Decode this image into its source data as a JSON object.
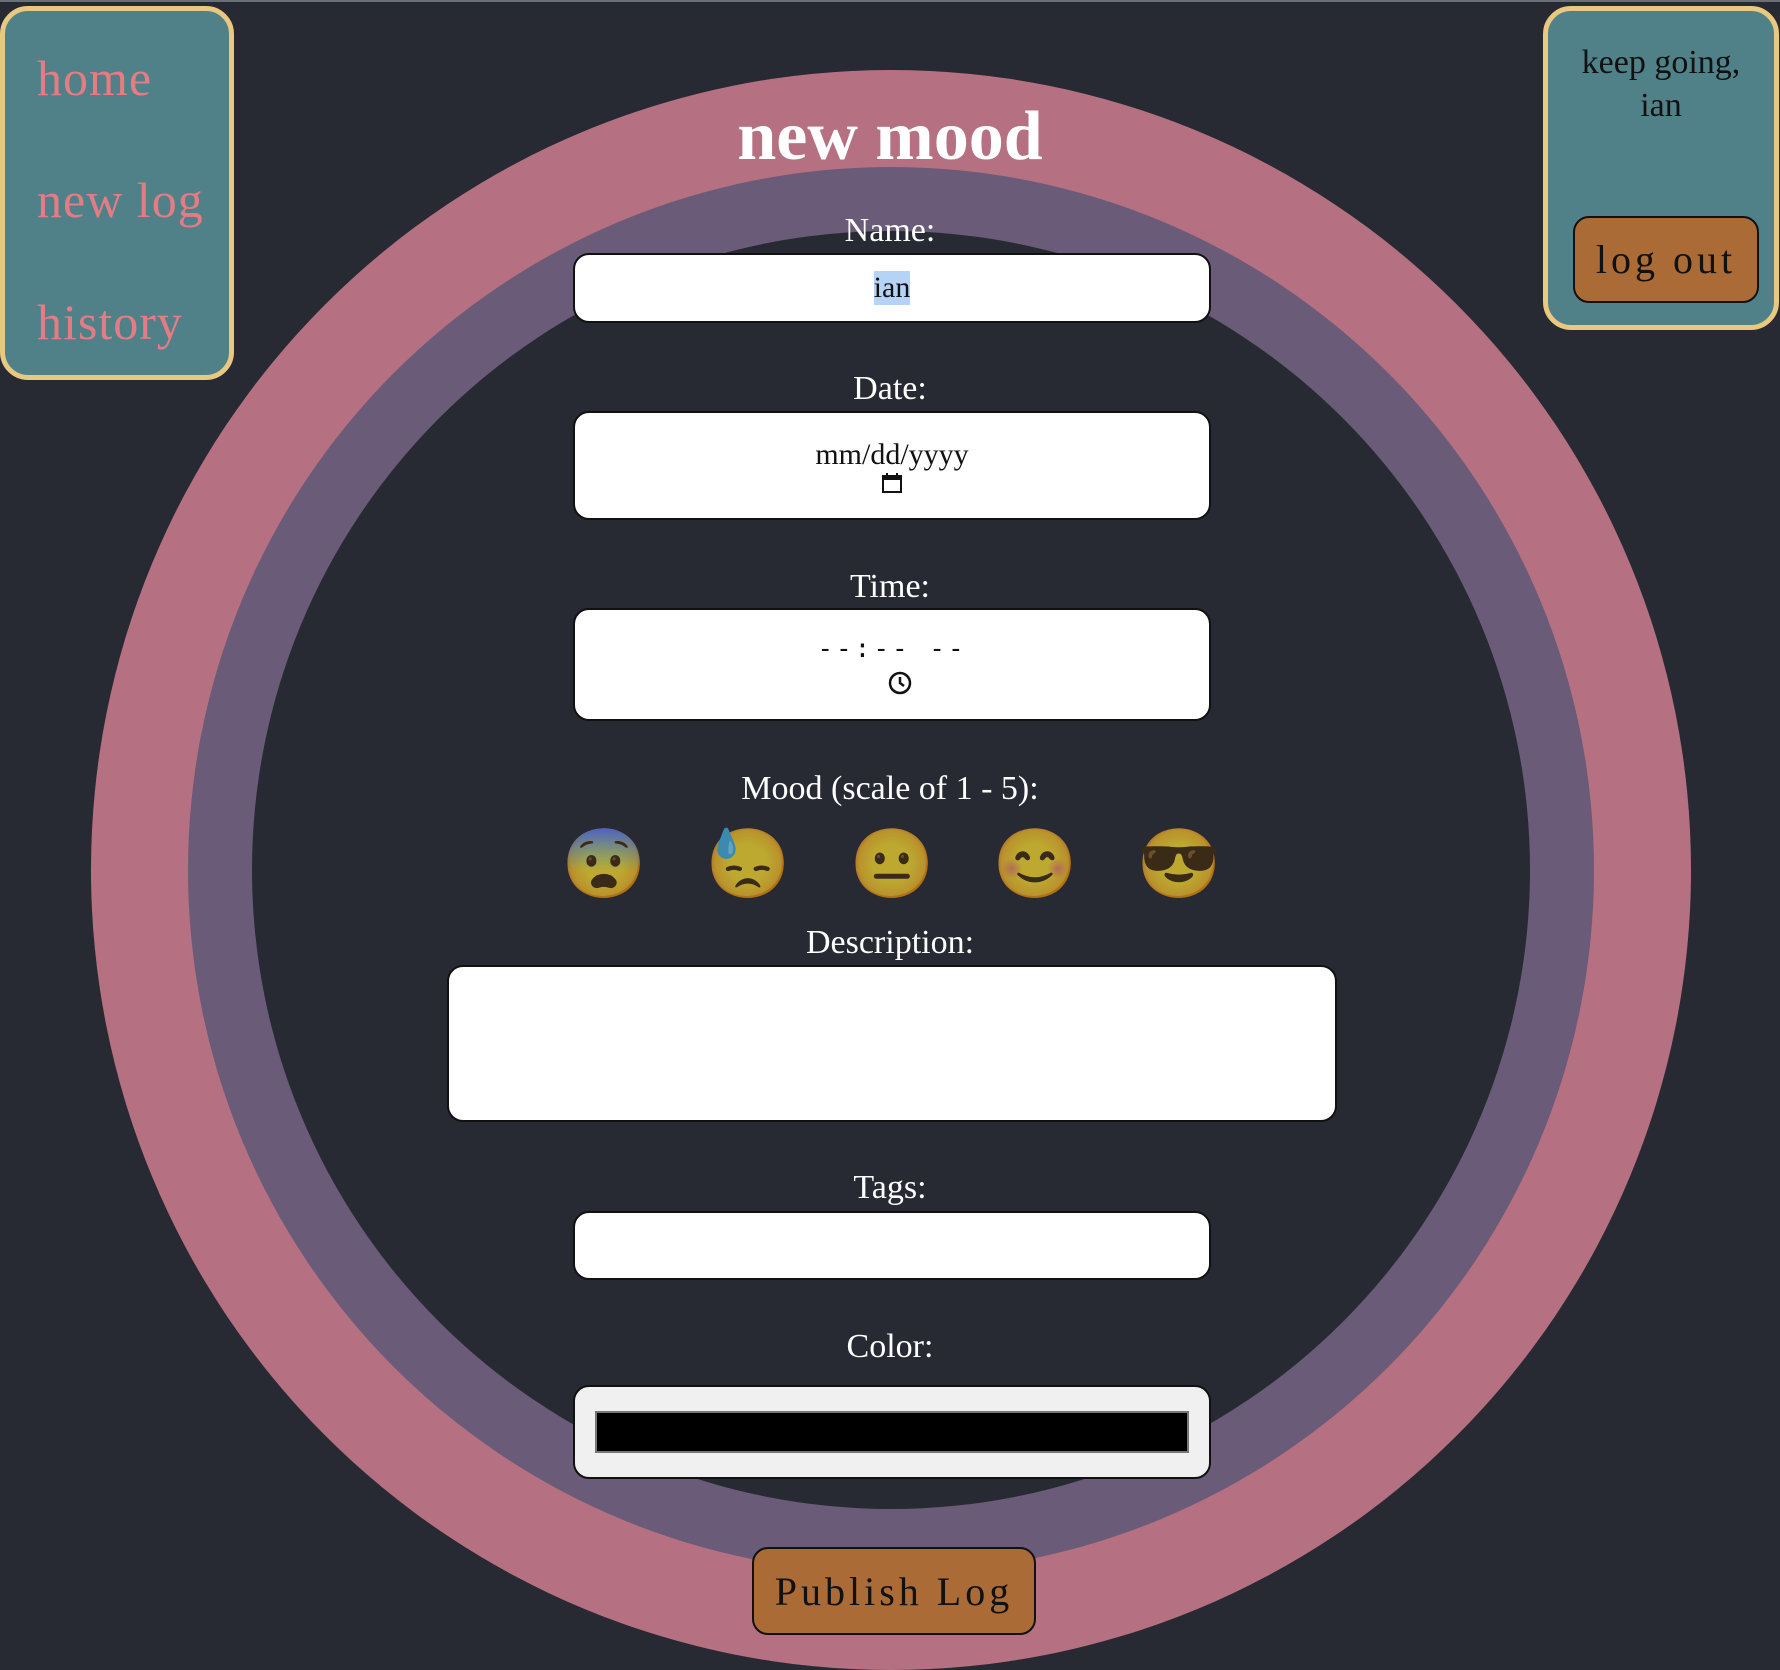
{
  "nav": {
    "items": [
      {
        "label": "home"
      },
      {
        "label": "new log"
      },
      {
        "label": "history"
      }
    ]
  },
  "side": {
    "greeting": "keep going, ian",
    "logout_label": "log out"
  },
  "form": {
    "title": "new mood",
    "name_label": "Name:",
    "name_value": "ian",
    "date_label": "Date:",
    "date_placeholder": "mm/dd/yyyy",
    "time_label": "Time:",
    "time_placeholder": "--:-- --",
    "mood_label": "Mood (scale of 1 - 5):",
    "moods": [
      "😨",
      "😓",
      "😐",
      "😊",
      "😎"
    ],
    "description_label": "Description:",
    "description_value": "",
    "tags_label": "Tags:",
    "tags_value": "",
    "color_label": "Color:",
    "color_value": "#000000",
    "publish_label": "Publish Log"
  },
  "colors": {
    "background": "#282a33",
    "outer_ring": "#b57181",
    "middle_ring": "#6a5b78",
    "panel": "#508189",
    "panel_border": "#e9c880",
    "button": "#ab6b36",
    "nav_link": "#e57c84"
  }
}
